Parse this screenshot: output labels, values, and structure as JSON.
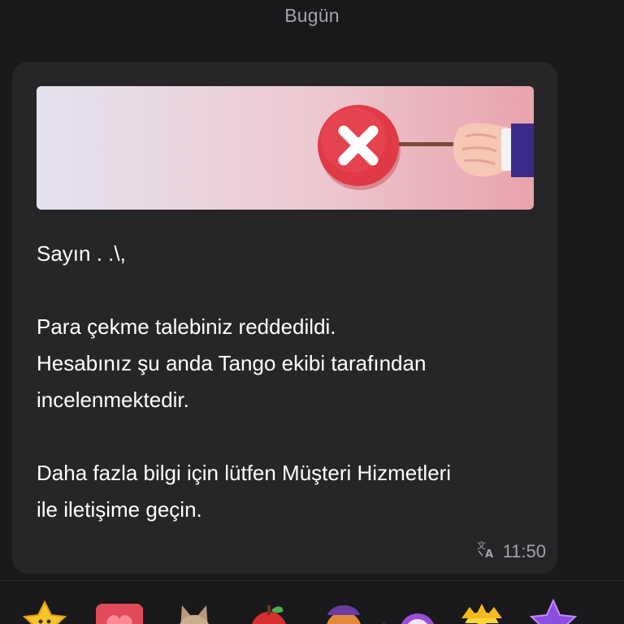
{
  "chat": {
    "day_separator": "Bugün"
  },
  "message": {
    "greeting": "Sayın . .\\,",
    "lines": [
      "Para çekme talebiniz reddedildi.",
      "Hesabınız şu anda Tango ekibi tarafından",
      "incelenmektedir.",
      "Daha fazla bilgi için lütfen Müşteri Hizmetleri",
      "ile iletişime geçin."
    ],
    "time": "11:50",
    "translate_icon": "translate-icon",
    "banner_icons": [
      "reject-x-icon",
      "hand-holding-sign-icon"
    ]
  },
  "gift_bar": {
    "items": [
      "star-gift-icon",
      "heart-gift-icon",
      "cat-gift-icon",
      "apple-gift-icon",
      "bear-gift-icon",
      "target-gift-icon",
      "sunglasses-gift-icon",
      "purple-star-gift-icon"
    ]
  },
  "colors": {
    "background": "#19191b",
    "bubble": "#262628",
    "reject_red": "#e03a47",
    "muted_text": "#a4a4a8"
  }
}
